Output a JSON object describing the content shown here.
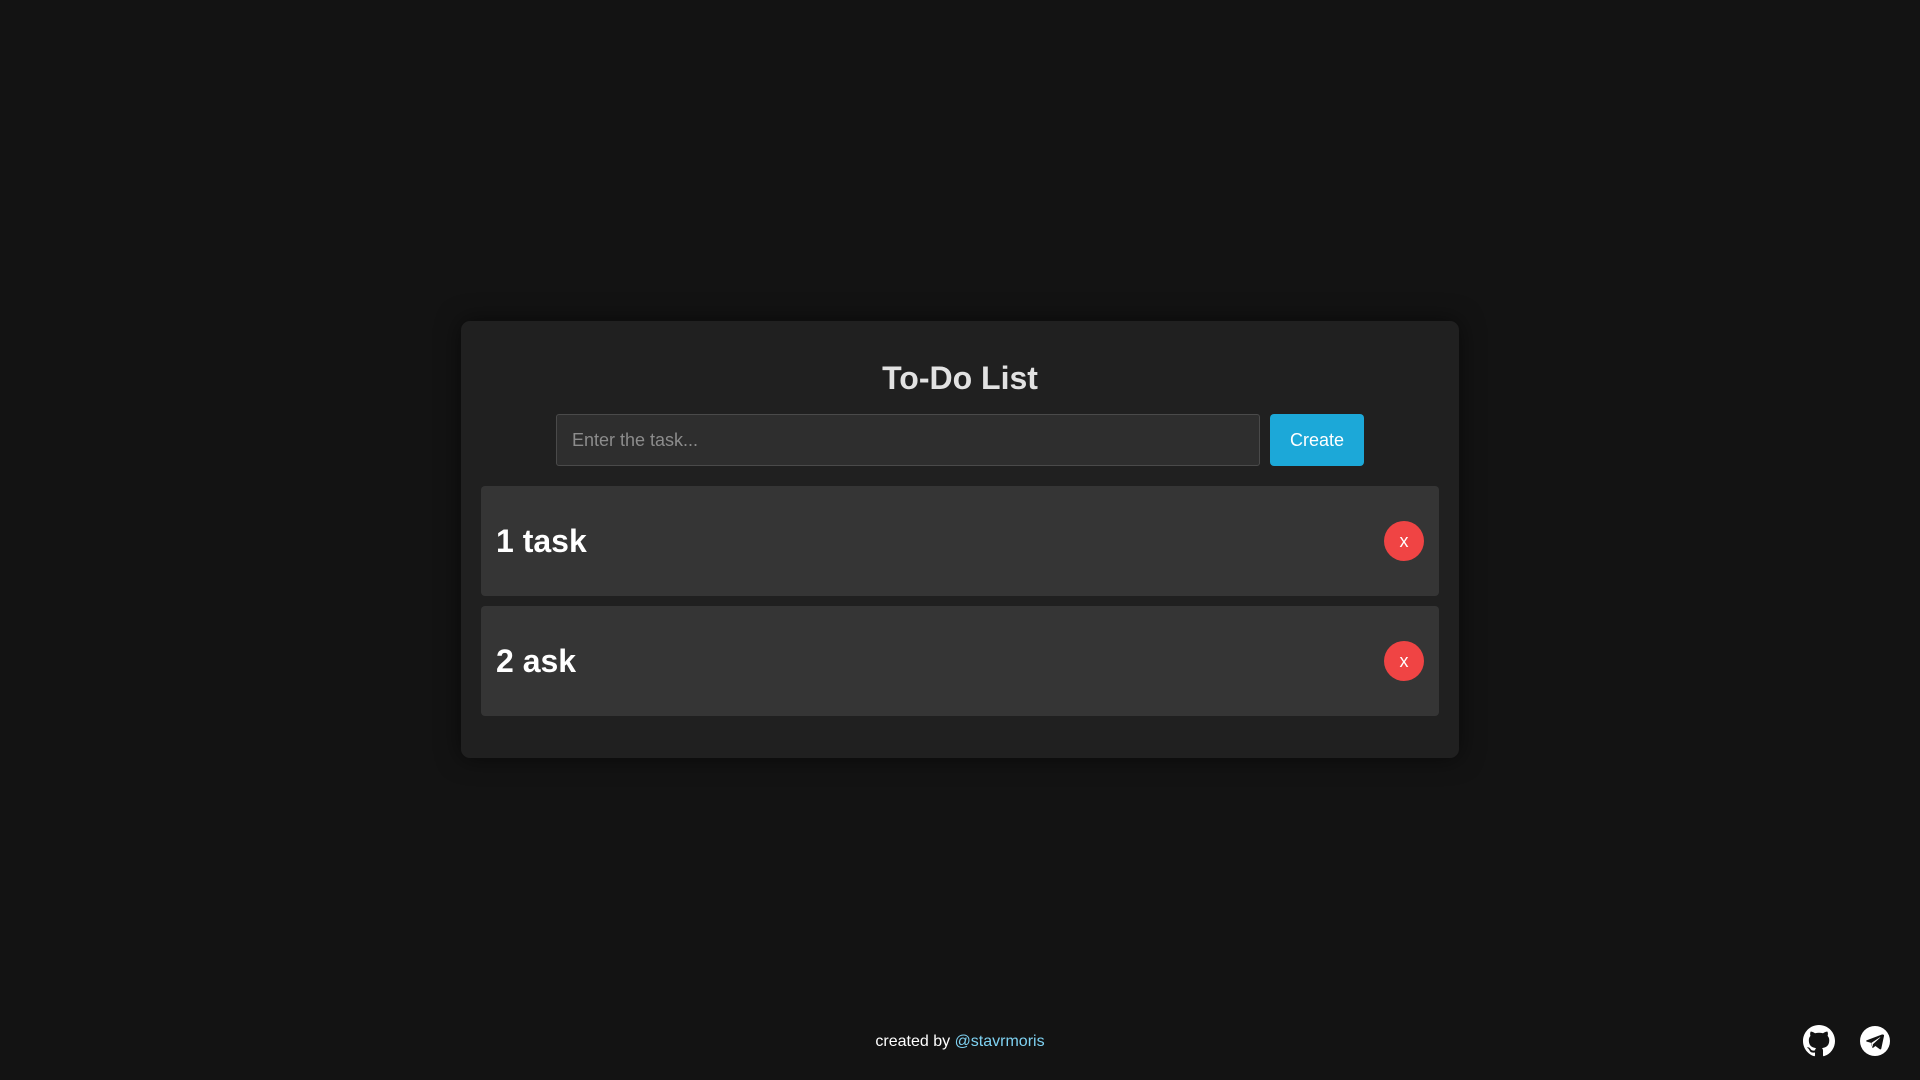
{
  "app": {
    "title": "To-Do List"
  },
  "form": {
    "input_value": "",
    "input_placeholder": "Enter the task...",
    "create_label": "Create"
  },
  "tasks": [
    {
      "label": "1 task",
      "delete_label": "x"
    },
    {
      "label": "2 ask",
      "delete_label": "x"
    }
  ],
  "footer": {
    "prefix": "created by",
    "author": "@stavrmoris"
  },
  "social": {
    "icons": [
      "github-icon",
      "telegram-icon"
    ]
  },
  "colors": {
    "background": "#131313",
    "card": "#202020",
    "task_item": "#353535",
    "accent": "#1ca8d8",
    "delete": "#f04444",
    "link": "#7fd2f2"
  }
}
